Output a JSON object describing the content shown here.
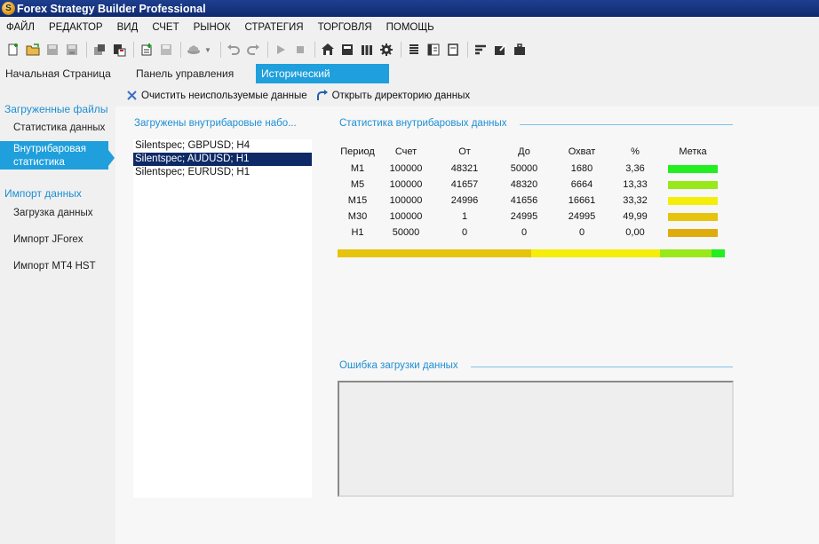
{
  "window": {
    "title": "Forex Strategy Builder Professional",
    "logo_letter": "S"
  },
  "menu": [
    "ФАЙЛ",
    "РЕДАКТОР",
    "ВИД",
    "СЧЕТ",
    "РЫНОК",
    "СТРАТЕГИЯ",
    "ТОРГОВЛЯ",
    "ПОМОЩЬ"
  ],
  "tabs": [
    {
      "label": "Начальная Страница"
    },
    {
      "label": "Панель управления"
    },
    {
      "label": "Исторический центр",
      "close": "✕"
    }
  ],
  "sidebar": {
    "section1": "Загруженные файлы",
    "item_stats": "Статистика данных",
    "item_intrabar_line1": "Внутрибаровая",
    "item_intrabar_line2": "статистика",
    "section2": "Импорт данных",
    "item_load": "Загрузка данных",
    "item_jforex": "Импорт JForex",
    "item_mt4": "Импорт MT4 HST"
  },
  "actions": {
    "clear_unused": "Очистить неиспользуемые данные",
    "open_dir": "Открыть директорию данных"
  },
  "files": {
    "title": "Загружены  внутрибаровые набо...",
    "items": [
      "Silentspec; GBPUSD; H4",
      "Silentspec; AUDUSD; H1",
      "Silentspec; EURUSD; H1"
    ]
  },
  "stats": {
    "title": "Статистика внутрибаровых данных",
    "headers": [
      "Период",
      "Счет",
      "От",
      "До",
      "Охват",
      "%",
      "Метка"
    ],
    "rows": [
      {
        "period": "M1",
        "count": "100000",
        "from": "48321",
        "to": "50000",
        "coverage": "1680",
        "percent": "3,36",
        "color": "#22ee22"
      },
      {
        "period": "M5",
        "count": "100000",
        "from": "41657",
        "to": "48320",
        "coverage": "6664",
        "percent": "13,33",
        "color": "#99e81a"
      },
      {
        "period": "M15",
        "count": "100000",
        "from": "24996",
        "to": "41656",
        "coverage": "16661",
        "percent": "33,32",
        "color": "#f4ee0a"
      },
      {
        "period": "M30",
        "count": "100000",
        "from": "1",
        "to": "24995",
        "coverage": "24995",
        "percent": "49,99",
        "color": "#e6c30c"
      },
      {
        "period": "H1",
        "count": "50000",
        "from": "0",
        "to": "0",
        "coverage": "0",
        "percent": "0,00",
        "color": "#e0ab0c"
      }
    ]
  },
  "errors": {
    "title": "Ошибка загрузки данных"
  },
  "icons": [
    "new-file-icon",
    "open-folder-icon",
    "save-icon",
    "save-as-icon",
    "copy-icon",
    "paste-icon",
    "add-indicator-icon",
    "save-indicator-icon",
    "hat-icon",
    "undo-icon",
    "redo-icon",
    "play-icon",
    "stop-icon",
    "home-icon",
    "terminal-icon",
    "library-icon",
    "settings-icon",
    "list-icon",
    "journal-icon",
    "page-icon",
    "align-icon",
    "export-icon",
    "briefcase-icon"
  ]
}
